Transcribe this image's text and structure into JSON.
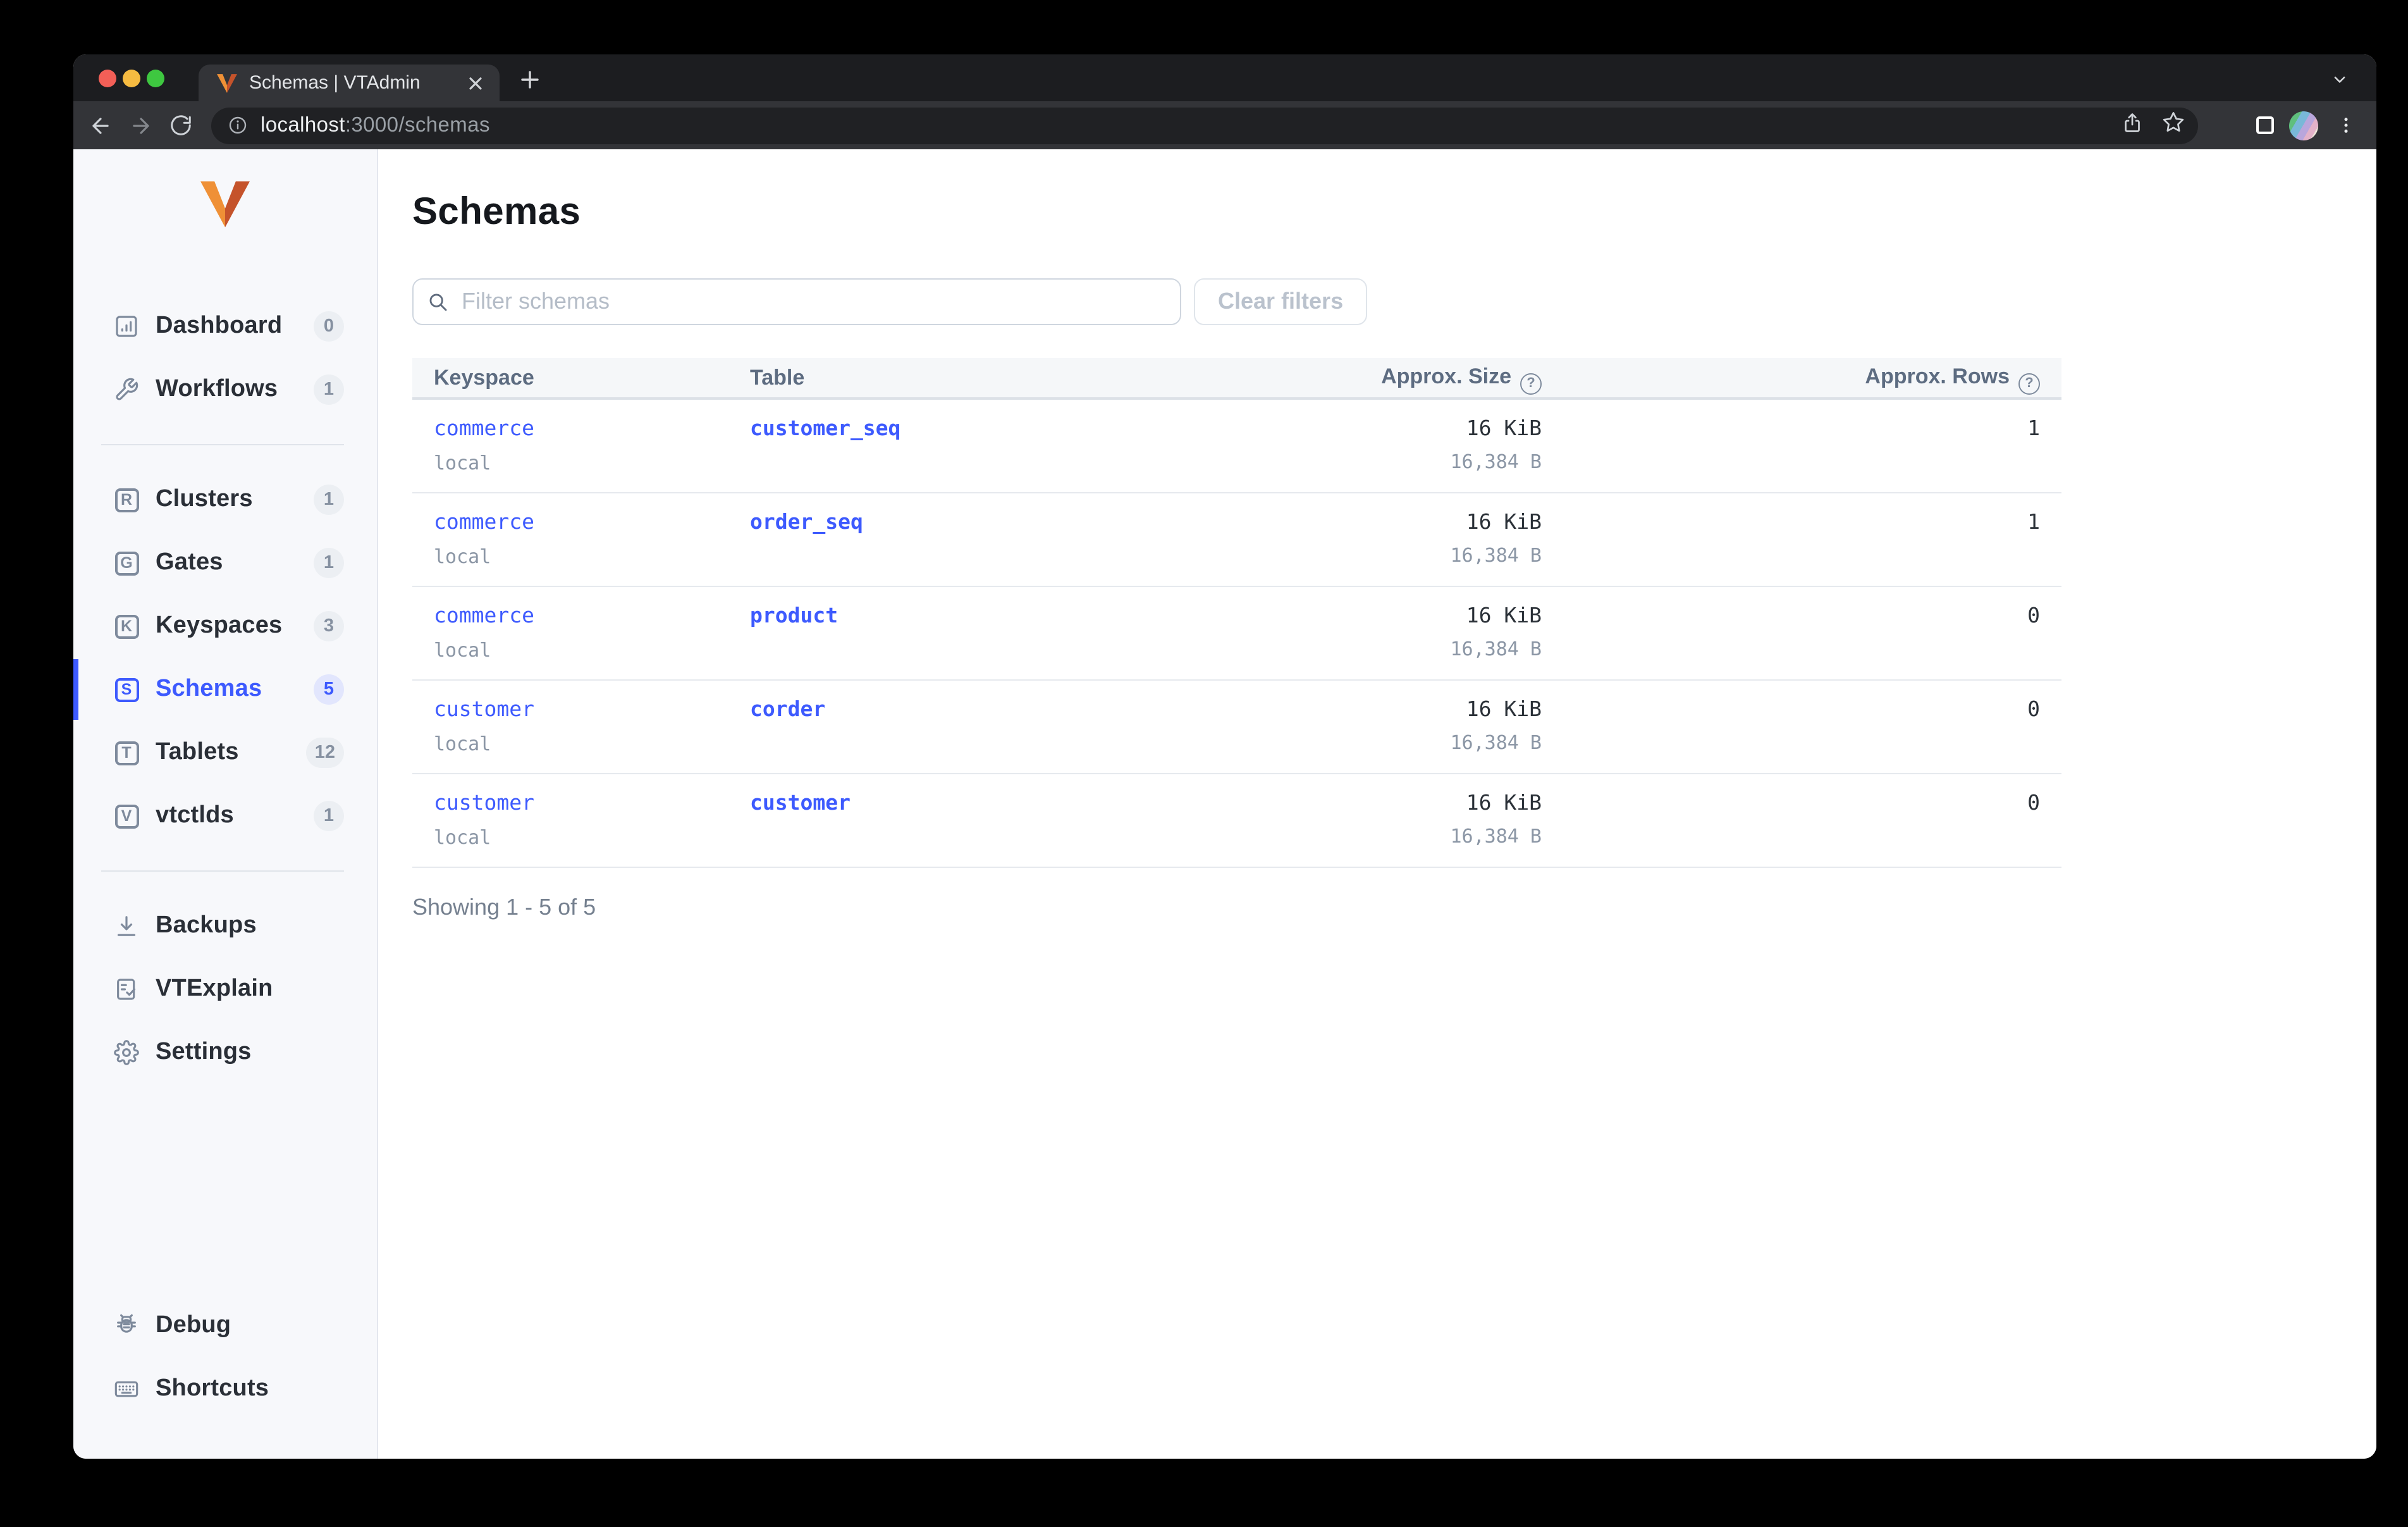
{
  "colors": {
    "accent": "#3d5afe",
    "active_badge_bg": "#e2e6fd",
    "sidebar_bg": "#f7f8fb",
    "link": "#3d5afe"
  },
  "browser": {
    "tab_title": "Schemas | VTAdmin",
    "url": {
      "host": "localhost",
      "rest": ":3000/schemas"
    }
  },
  "sidebar": {
    "sections": [
      {
        "items": [
          {
            "label": "Dashboard",
            "count": "0",
            "icon": "dashboard"
          },
          {
            "label": "Workflows",
            "count": "1",
            "icon": "wrench"
          }
        ]
      },
      {
        "items": [
          {
            "label": "Clusters",
            "count": "1",
            "icon": "letter",
            "letter": "R"
          },
          {
            "label": "Gates",
            "count": "1",
            "icon": "letter",
            "letter": "G"
          },
          {
            "label": "Keyspaces",
            "count": "3",
            "icon": "letter",
            "letter": "K"
          },
          {
            "label": "Schemas",
            "count": "5",
            "icon": "letter",
            "letter": "S",
            "active": true
          },
          {
            "label": "Tablets",
            "count": "12",
            "icon": "letter",
            "letter": "T"
          },
          {
            "label": "vtctlds",
            "count": "1",
            "icon": "letter",
            "letter": "V"
          }
        ]
      },
      {
        "items": [
          {
            "label": "Backups",
            "icon": "download"
          },
          {
            "label": "VTExplain",
            "icon": "clipboard-check"
          },
          {
            "label": "Settings",
            "icon": "gear"
          }
        ]
      }
    ],
    "bottom_items": [
      {
        "label": "Debug",
        "icon": "bug"
      },
      {
        "label": "Shortcuts",
        "icon": "keyboard"
      }
    ]
  },
  "page": {
    "title": "Schemas",
    "filter_placeholder": "Filter schemas",
    "clear_filters_label": "Clear filters",
    "footer": "Showing 1 - 5 of 5"
  },
  "table": {
    "headers": [
      {
        "label": "Keyspace",
        "help": false
      },
      {
        "label": "Table",
        "help": false
      },
      {
        "label": "Approx. Size",
        "help": true
      },
      {
        "label": "Approx. Rows",
        "help": true
      }
    ],
    "rows": [
      {
        "keyspace": "commerce",
        "cluster": "local",
        "table": "customer_seq",
        "size": "16 KiB",
        "size_bytes": "16,384 B",
        "approx_rows": "1"
      },
      {
        "keyspace": "commerce",
        "cluster": "local",
        "table": "order_seq",
        "size": "16 KiB",
        "size_bytes": "16,384 B",
        "approx_rows": "1"
      },
      {
        "keyspace": "commerce",
        "cluster": "local",
        "table": "product",
        "size": "16 KiB",
        "size_bytes": "16,384 B",
        "approx_rows": "0"
      },
      {
        "keyspace": "customer",
        "cluster": "local",
        "table": "corder",
        "size": "16 KiB",
        "size_bytes": "16,384 B",
        "approx_rows": "0"
      },
      {
        "keyspace": "customer",
        "cluster": "local",
        "table": "customer",
        "size": "16 KiB",
        "size_bytes": "16,384 B",
        "approx_rows": "0"
      }
    ]
  }
}
